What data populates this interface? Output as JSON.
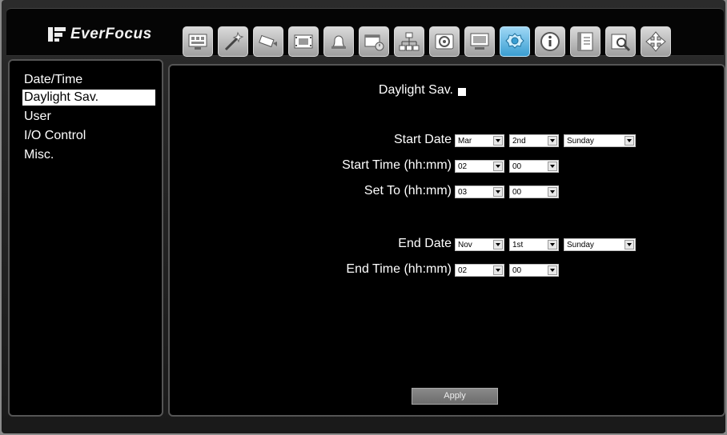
{
  "brand": {
    "name": "EverFocus"
  },
  "toolbar": {
    "icons": [
      "monitor-grid-icon",
      "magic-wand-icon",
      "camera-icon",
      "film-icon",
      "alarm-bell-icon",
      "schedule-icon",
      "network-icon",
      "disk-icon",
      "display-icon",
      "system-settings-icon",
      "info-icon",
      "log-book-icon",
      "search-icon",
      "ptz-arrows-icon"
    ],
    "active_index": 9
  },
  "sidebar": {
    "items": [
      {
        "label": "Date/Time"
      },
      {
        "label": "Daylight Sav."
      },
      {
        "label": "User"
      },
      {
        "label": "I/O Control"
      },
      {
        "label": "Misc."
      }
    ],
    "selected_index": 1
  },
  "form": {
    "dst_label": "Daylight Sav.",
    "dst_checked": false,
    "start_date_label": "Start Date",
    "start_date": {
      "month": "Mar",
      "week": "2nd",
      "day": "Sunday"
    },
    "start_time_label": "Start Time (hh:mm)",
    "start_time": {
      "hour": "02",
      "minute": "00"
    },
    "set_to_label": "Set To (hh:mm)",
    "set_to": {
      "hour": "03",
      "minute": "00"
    },
    "end_date_label": "End Date",
    "end_date": {
      "month": "Nov",
      "week": "1st",
      "day": "Sunday"
    },
    "end_time_label": "End Time (hh:mm)",
    "end_time": {
      "hour": "02",
      "minute": "00"
    },
    "apply_label": "Apply"
  },
  "colors": {
    "background": "#000000",
    "active_icon": "#3a9ed2",
    "selected_item": "#ffffff"
  }
}
